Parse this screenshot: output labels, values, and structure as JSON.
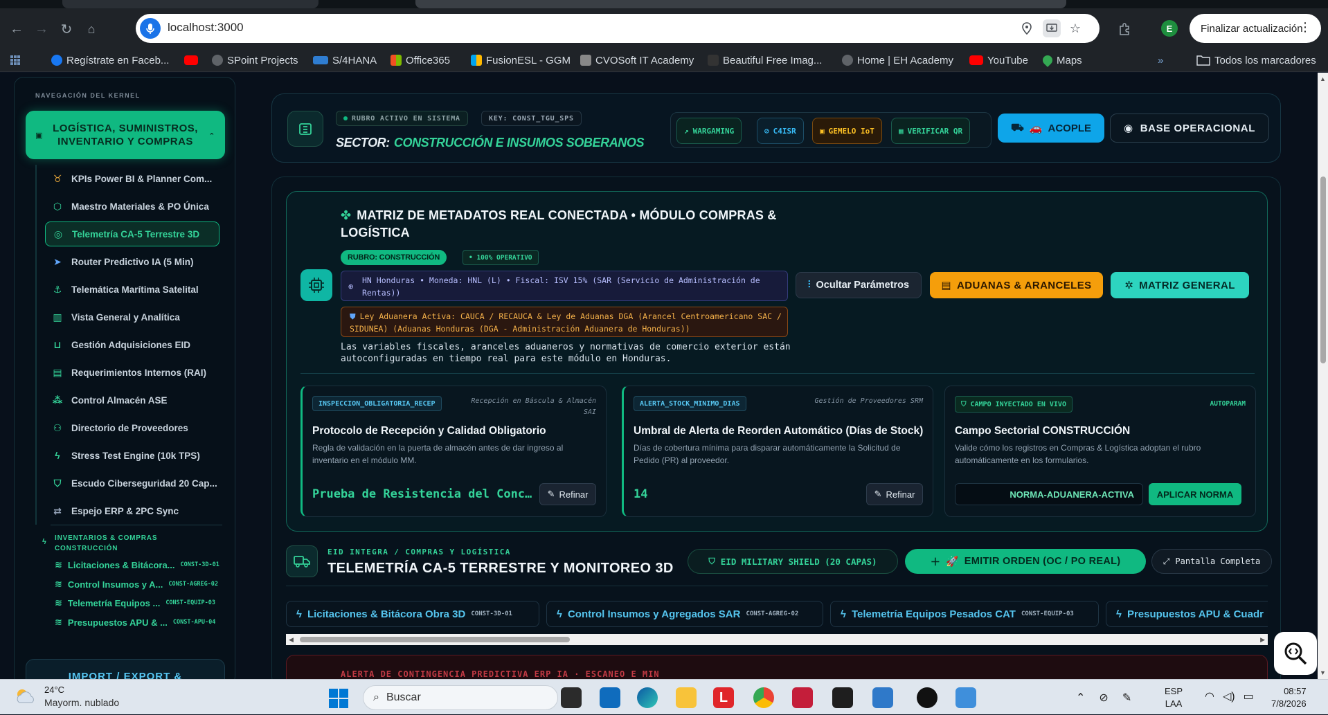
{
  "browser": {
    "url": "localhost:3000",
    "profile_initial": "E",
    "update_label": "Finalizar actualización",
    "bookmarks": [
      {
        "label": "Regístrate en Faceb...",
        "color": "#1877f2"
      },
      {
        "label": "",
        "color": "#ff0000"
      },
      {
        "label": "SPoint Projects",
        "color": "#5f6368"
      },
      {
        "label": "S/4HANA",
        "color": "#2f7dd1"
      },
      {
        "label": "Office365",
        "color": "#f25022"
      },
      {
        "label": "FusionESL - GGM",
        "color": "#f25022"
      },
      {
        "label": "CVOSoft IT Academy",
        "color": "#888888"
      },
      {
        "label": "Beautiful Free Imag...",
        "color": "#333333"
      },
      {
        "label": "Home | EH Academy",
        "color": "#5f6368"
      },
      {
        "label": "YouTube",
        "color": "#ff0000"
      },
      {
        "label": "Maps",
        "color": "#34a853"
      }
    ],
    "all_bookmarks": "Todos los marcadores"
  },
  "sidebar": {
    "caption": "NAVEGACIÓN DEL KERNEL",
    "section_label_1": "LOGÍSTICA, SUMINISTROS,",
    "section_label_2": "INVENTARIO Y COMPRAS",
    "items": [
      {
        "label": "KPIs Power BI & Planner Com...",
        "icon": "award-icon"
      },
      {
        "label": "Maestro Materiales & PO Única",
        "icon": "box-icon"
      },
      {
        "label": "Telemetría CA-5 Terrestre 3D",
        "icon": "radar-icon",
        "active": true
      },
      {
        "label": "Router Predictivo IA (5 Min)",
        "icon": "send-icon"
      },
      {
        "label": "Telemática Marítima Satelital",
        "icon": "anchor-icon"
      },
      {
        "label": "Vista General y Analítica",
        "icon": "bar-chart-icon"
      },
      {
        "label": "Gestión Adquisiciones EID",
        "icon": "cart-icon"
      },
      {
        "label": "Requerimientos Internos (RAI)",
        "icon": "clipboard-icon"
      },
      {
        "label": "Control Almacén ASE",
        "icon": "boxes-icon"
      },
      {
        "label": "Directorio de Proveedores",
        "icon": "users-icon"
      },
      {
        "label": "Stress Test Engine (10k TPS)",
        "icon": "zap-icon"
      },
      {
        "label": "Escudo Ciberseguridad 20 Cap...",
        "icon": "shield-icon"
      },
      {
        "label": "Espejo ERP & 2PC Sync",
        "icon": "sync-icon"
      }
    ],
    "sub_caption": "INVENTARIOS & COMPRAS CONSTRUCCIÓN",
    "sub_items": [
      {
        "label": "Licitaciones & Bitácora...",
        "code": "CONST-3D-01"
      },
      {
        "label": "Control Insumos y A...",
        "code": "CONST-AGREG-02"
      },
      {
        "label": "Telemetría Equipos ...",
        "code": "CONST-EQUIP-03"
      },
      {
        "label": "Presupuestos APU & ...",
        "code": "CONST-APU-04"
      }
    ],
    "import_label": "IMPORT / EXPORT &"
  },
  "header": {
    "rubro_active": "RUBRO ACTIVO EN SISTEMA",
    "key": "KEY: CONST_TGU_SPS",
    "sector_label": "SECTOR:",
    "sector_value": "CONSTRUCCIÓN E INSUMOS SOBERANOS",
    "tools": [
      {
        "label": "WARGAMING",
        "icon": "trend-icon",
        "color": "#34d399",
        "bg": "#0a2320",
        "border": "#1a5c4d"
      },
      {
        "label": "C4ISR",
        "icon": "compass-icon",
        "color": "#38bdf8",
        "bg": "#0a1f2c",
        "border": "#1c4d66"
      },
      {
        "label": "GEMELO IoT",
        "icon": "cpu-icon",
        "color": "#fbbf24",
        "bg": "#2a1a08",
        "border": "#7a4a10"
      },
      {
        "label": "VERIFICAR QR",
        "icon": "qr-icon",
        "color": "#34d399",
        "bg": "#0a2320",
        "border": "#1a5c4d"
      }
    ],
    "acople_label": "ACOPLE",
    "base_label": "BASE OPERACIONAL"
  },
  "meta": {
    "title": "MATRIZ DE METADATOS REAL CONECTADA • MÓDULO COMPRAS & LOGÍSTICA",
    "rubro_pill": "RUBRO: CONSTRUCCIÓN",
    "oper_pill": "• 100% OPERATIVO",
    "fiscal": "HN Honduras • Moneda: HNL (L) • Fiscal: ISV 15% (SAR (Servicio de Administración de Rentas))",
    "ley": "Ley Aduanera Activa: CAUCA / RECAUCA & Ley de Aduanas DGA (Arancel Centroamericano SAC / SIDUNEA) (Aduanas Honduras (DGA - Administración Aduanera de Honduras))",
    "desc": "Las variables fiscales, aranceles aduaneros y normativas de comercio exterior están autoconfiguradas en tiempo real para este módulo en Honduras.",
    "ocultar_label": "Ocultar Parámetros",
    "aduanas_label": "ADUANAS & ARANCELES",
    "matriz_label": "MATRIZ GENERAL",
    "cards": [
      {
        "code": "INSPECCION_OBLIGATORIA_RECEP",
        "tag": "Recepción en Báscula & Almacén SAI",
        "title": "Protocolo de Recepción y Calidad Obligatorio",
        "desc": "Regla de validación en la puerta de almacén antes de dar ingreso al inventario en el módulo MM.",
        "value": "Prueba de Resistencia del Concreto",
        "refine": "Refinar"
      },
      {
        "code": "ALERTA_STOCK_MINIMO_DIAS",
        "tag": "Gestión de Proveedores SRM",
        "title": "Umbral de Alerta de Reorden Automático (Días de Stock)",
        "desc": "Días de cobertura mínima para disparar automáticamente la Solicitud de Pedido (PR) al proveedor.",
        "value": "14",
        "refine": "Refinar"
      },
      {
        "badge": "CAMPO INYECTADO EN VIVO",
        "auto": "AUTOPARAM",
        "title": "Campo Sectorial CONSTRUCCIÓN",
        "desc": "Valide cómo los registros en Compras & Logística adoptan el rubro automáticamente en los formularios.",
        "input_value": "NORMA-ADUANERA-ACTIVA",
        "apply": "APLICAR NORMA"
      }
    ]
  },
  "telemetry": {
    "caption": "EID INTEGRA / COMPRAS Y LOGÍSTICA",
    "title": "TELEMETRÍA CA-5 TERRESTRE Y MONITOREO 3D",
    "shield": "EID MILITARY SHIELD (20 CAPAS)",
    "emitir": "EMITIR ORDEN (OC / PO REAL)",
    "fullscreen": "Pantalla Completa",
    "chips": [
      {
        "label": "Licitaciones & Bitácora Obra 3D",
        "code": "CONST-3D-01"
      },
      {
        "label": "Control Insumos y Agregados SAR",
        "code": "CONST-AGREG-02"
      },
      {
        "label": "Telemetría Equipos Pesados CAT",
        "code": "CONST-EQUIP-03"
      },
      {
        "label": "Presupuestos APU & Cuadr",
        "code": ""
      }
    ],
    "alert_text": "ALERTA DE CONTINGENCIA PREDICTIVA ERP IA · ESCANEO E MIN"
  },
  "taskbar": {
    "temp": "24°C",
    "weather": "Mayorm. nublado",
    "search": "Buscar",
    "lang_1": "ESP",
    "lang_2": "LAA",
    "time": "08:57",
    "date": "7/8/2026"
  },
  "colors": {
    "accent": "#10b981",
    "info": "#0ea5e9",
    "warning": "#f59e0b",
    "teal": "#2dd4bf"
  }
}
